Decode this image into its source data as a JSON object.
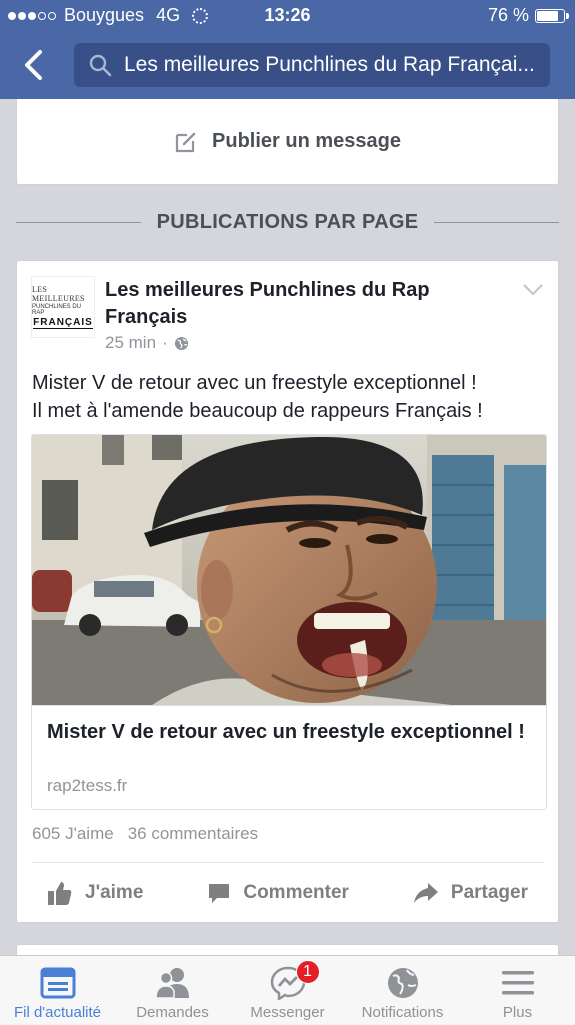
{
  "status_bar": {
    "carrier": "Bouygues",
    "network": "4G",
    "time": "13:26",
    "battery": "76 %",
    "battery_level": 0.76
  },
  "nav": {
    "back_icon": "back-chevron-icon",
    "search_text": "Les meilleures Punchlines du Rap Françai..."
  },
  "composer": {
    "label": "Publier un message",
    "icon": "edit-icon"
  },
  "section": {
    "title": "PUBLICATIONS PAR PAGE"
  },
  "post": {
    "logo": {
      "line1": "LES MEILLEURES",
      "line2": "PUNCHLINES DU RAP",
      "line3": "FRANÇAIS"
    },
    "page_name": "Les meilleures Punchlines du Rap Français",
    "time": "25 min",
    "separator": "·",
    "privacy_icon": "globe-icon",
    "text_line1": "Mister V de retour avec un freestyle exceptionnel !",
    "text_line2": "Il met à l'amende beaucoup de rappeurs Français !",
    "link": {
      "title": "Mister V de retour avec un freestyle exceptionnel !",
      "domain": "rap2tess.fr"
    },
    "likes": "605 J'aime",
    "comments": "36 commentaires",
    "actions": {
      "like": "J'aime",
      "comment": "Commenter",
      "share": "Partager"
    }
  },
  "tabbar": {
    "tabs": [
      {
        "label": "Fil d'actualité",
        "icon": "news-feed-icon",
        "active": true
      },
      {
        "label": "Demandes",
        "icon": "friend-requests-icon"
      },
      {
        "label": "Messenger",
        "icon": "messenger-icon",
        "badge": "1"
      },
      {
        "label": "Notifications",
        "icon": "globe-notifications-icon"
      },
      {
        "label": "Plus",
        "icon": "menu-icon"
      }
    ]
  },
  "colors": {
    "header": "#4a67a6",
    "search_bg": "#394f88",
    "active_tab": "#4a80d4",
    "badge": "#e41e26"
  }
}
